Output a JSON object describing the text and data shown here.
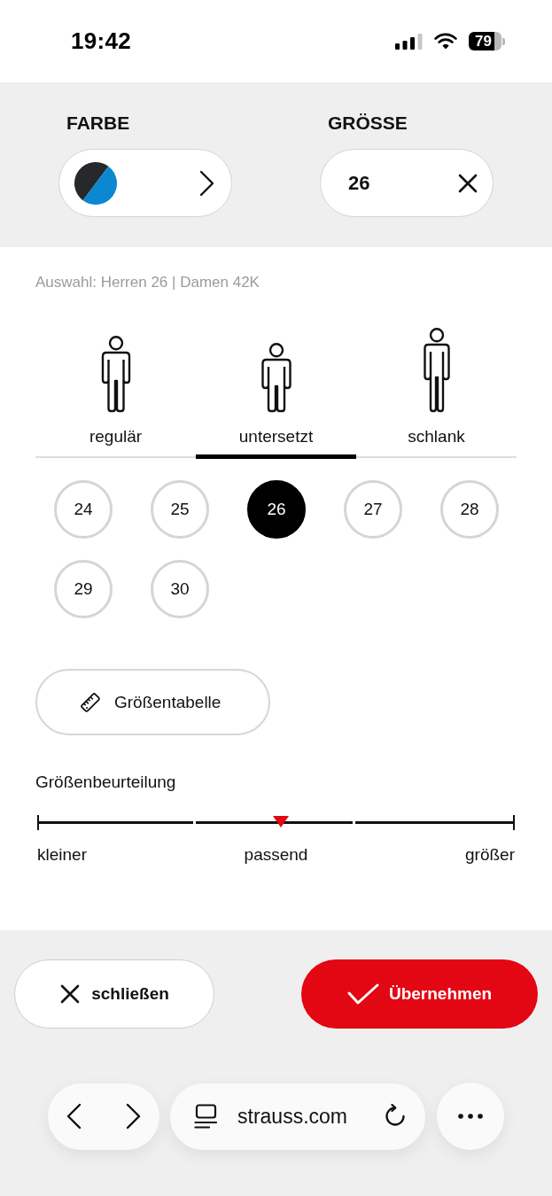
{
  "status_bar": {
    "time": "19:42",
    "battery": "79"
  },
  "filters": [
    {
      "kind": "color",
      "label": "FARBE",
      "swatch": [
        {
          "color": "#27282c"
        },
        {
          "color": "#0c87d2"
        }
      ]
    },
    {
      "kind": "size",
      "label": "GRÖSSE",
      "value": "26"
    }
  ],
  "selection_summary": "Auswahl: Herren 26 | Damen 42K",
  "fit_tabs": [
    {
      "kind": "regular",
      "label": "regulär",
      "selected": false
    },
    {
      "kind": "stocky",
      "label": "untersetzt",
      "selected": true
    },
    {
      "kind": "slim",
      "label": "schlank",
      "selected": false
    }
  ],
  "sizes": [
    {
      "label": "24",
      "selected": false
    },
    {
      "label": "25",
      "selected": false
    },
    {
      "label": "26",
      "selected": true
    },
    {
      "label": "27",
      "selected": false
    },
    {
      "label": "28",
      "selected": false
    },
    {
      "label": "29",
      "selected": false
    },
    {
      "label": "30",
      "selected": false
    }
  ],
  "size_chart_button": {
    "label": "Größentabelle"
  },
  "fit_rating": {
    "title": "Größenbeurteilung",
    "level": 0.51,
    "scale_labels": [
      "kleiner",
      "passend",
      "größer"
    ]
  },
  "actions": [
    {
      "kind": "close",
      "label": "schließen"
    },
    {
      "kind": "apply",
      "label": "Übernehmen"
    }
  ],
  "browser_bar": {
    "url": "strauss.com"
  }
}
